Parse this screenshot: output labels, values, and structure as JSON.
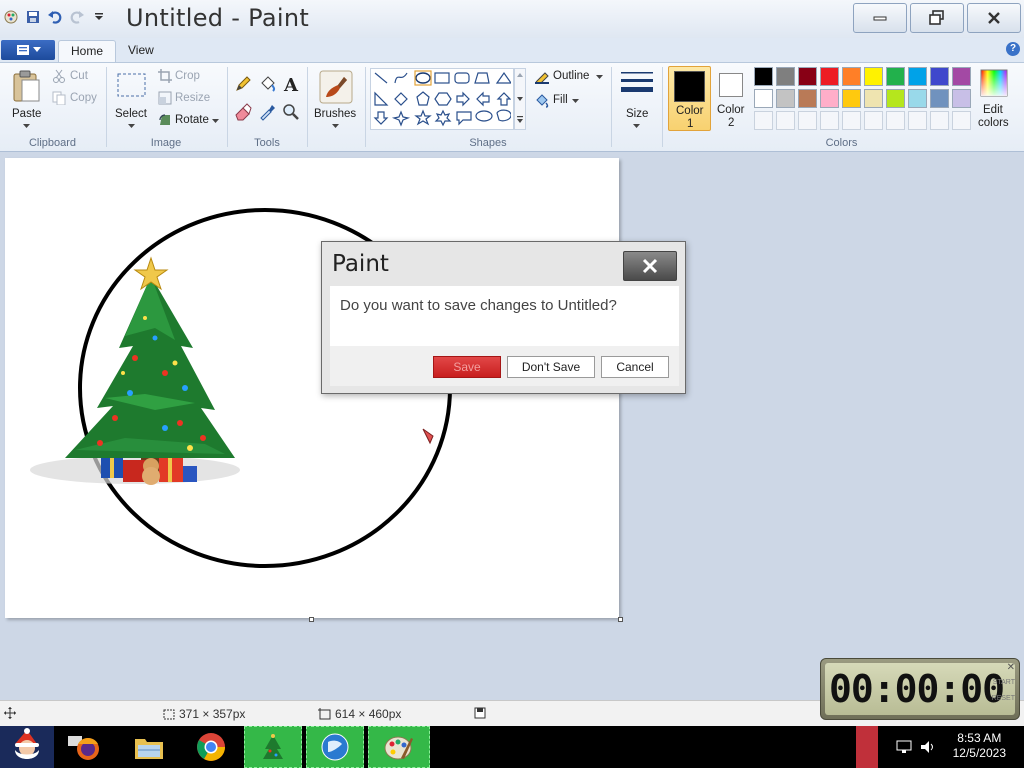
{
  "window": {
    "title": "Untitled - Paint",
    "controls": {
      "minimize": "minimize",
      "maximize": "restore",
      "close": "close"
    }
  },
  "ribbon": {
    "tabs": [
      {
        "label": "Home",
        "active": true
      },
      {
        "label": "View",
        "active": false
      }
    ],
    "clipboard": {
      "paste": "Paste",
      "cut": "Cut",
      "copy": "Copy",
      "group": "Clipboard"
    },
    "image": {
      "select": "Select",
      "crop": "Crop",
      "resize": "Resize",
      "rotate": "Rotate",
      "group": "Image"
    },
    "tools": {
      "group": "Tools"
    },
    "brushes": {
      "label": "Brushes"
    },
    "shapes": {
      "outline": "Outline",
      "fill": "Fill",
      "group": "Shapes"
    },
    "size": {
      "label": "Size"
    },
    "colors": {
      "color1": "Color",
      "color1_num": "1",
      "color2": "Color",
      "color2_num": "2",
      "edit_line1": "Edit",
      "edit_line2": "colors",
      "group": "Colors",
      "color1_value": "#000000",
      "color2_value": "#ffffff",
      "palette_row1": [
        "#000000",
        "#7f7f7f",
        "#880015",
        "#ed1c24",
        "#ff7f27",
        "#fff200",
        "#22b14c",
        "#00a2e8",
        "#3f48cc",
        "#a349a4"
      ],
      "palette_row2": [
        "#ffffff",
        "#c3c3c3",
        "#b97a57",
        "#ffaec9",
        "#ffc90e",
        "#efe4b0",
        "#b5e61d",
        "#99d9ea",
        "#7092be",
        "#c8bfe7"
      ]
    }
  },
  "dialog": {
    "title": "Paint",
    "message": "Do you want to save changes to Untitled?",
    "buttons": {
      "save": "Save",
      "dont_save": "Don't Save",
      "cancel": "Cancel"
    }
  },
  "status": {
    "selection_size": "371 × 357px",
    "canvas_size": "614 × 460px"
  },
  "timer": {
    "display": "00:00:00",
    "side_top": "START",
    "side_bottom": "RESET"
  },
  "taskbar": {
    "time": "8:53 AM",
    "date": "12/5/2023"
  }
}
